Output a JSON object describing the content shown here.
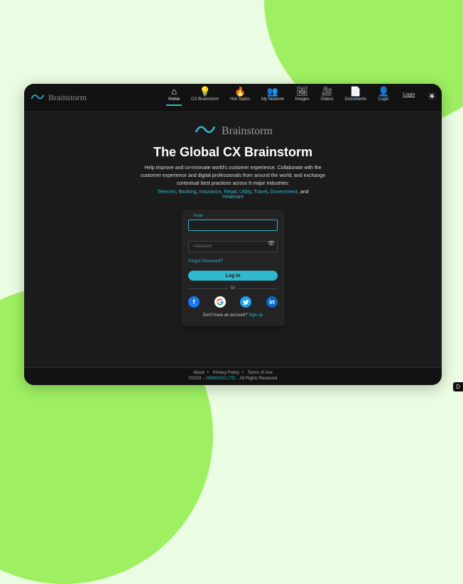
{
  "brand": {
    "name": "Brainstorm"
  },
  "nav": {
    "items": [
      {
        "label": "Home",
        "icon": "⌂",
        "active": true
      },
      {
        "label": "CX Brainstorm",
        "icon": "💡",
        "active": false
      },
      {
        "label": "Hot Topics",
        "icon": "🔥",
        "active": false
      },
      {
        "label": "My Network",
        "icon": "👥",
        "active": false
      },
      {
        "label": "Images",
        "icon": "🖼",
        "active": false
      },
      {
        "label": "Videos",
        "icon": "🎥",
        "active": false
      },
      {
        "label": "Documents",
        "icon": "📄",
        "active": false
      },
      {
        "label": "Login",
        "icon": "👤",
        "active": false
      }
    ],
    "login_link": "Login"
  },
  "hero": {
    "title": "The Global CX Brainstorm",
    "subtitle": "Help improve and co-innovate world's customer experience. Collaborate with the customer experience and digital professionals from around the world, and exchange contextual best practices across 8 major industries:",
    "industries": [
      "Telecom",
      "Banking",
      "Insurance",
      "Retail",
      "Utility",
      "Travel",
      "Government"
    ],
    "industries_and": ", and",
    "industries_last": "Healtcare"
  },
  "login_form": {
    "email_label": "Email",
    "email_value": "",
    "password_placeholder": "Password",
    "forgot": "Forgot Password?",
    "button": "Log In",
    "or": "Or",
    "no_account": "Don't have an account? ",
    "signup": "Sign up"
  },
  "social": {
    "facebook": "f",
    "google": "G",
    "twitter": "t",
    "linkedin": "in"
  },
  "footer": {
    "about": "About",
    "privacy": "Privacy Policy",
    "terms": "Terms of Use",
    "copyright_prefix": "©2023 – ",
    "company": "OMNIXCO LTD.",
    "rights": " . All Rights Reserved"
  },
  "corner": "D"
}
